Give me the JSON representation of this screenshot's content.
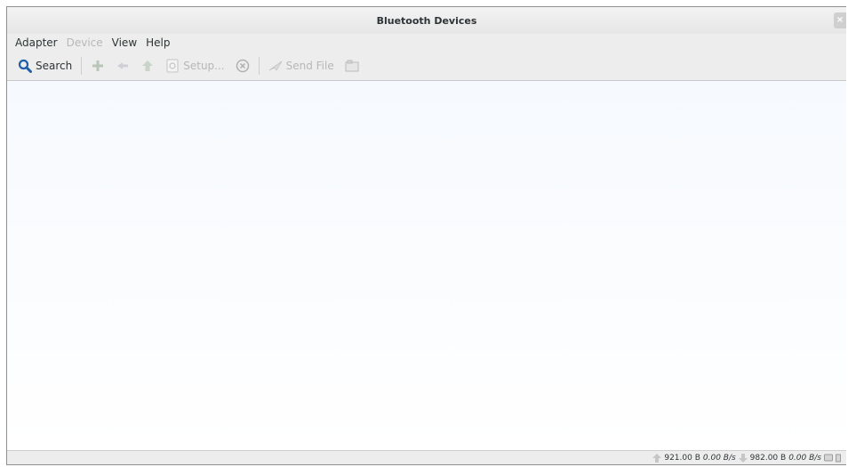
{
  "window": {
    "title": "Bluetooth Devices",
    "close_label": "×"
  },
  "menu": [
    {
      "label": "Adapter",
      "enabled": true
    },
    {
      "label": "Device",
      "enabled": false
    },
    {
      "label": "View",
      "enabled": true
    },
    {
      "label": "Help",
      "enabled": true
    }
  ],
  "toolbar": {
    "search_label": "Search",
    "setup_label": "Setup...",
    "send_file_label": "Send File"
  },
  "status": {
    "upload_total": "921.00 B",
    "upload_rate": "0.00 B/s",
    "download_total": "982.00 B",
    "download_rate": "0.00 B/s"
  },
  "colors": {
    "accent": "#1f5fa9",
    "disabled_icon": "#b9c5b9"
  }
}
